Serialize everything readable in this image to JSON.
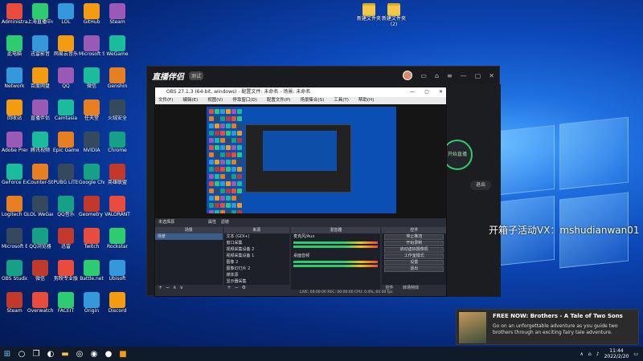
{
  "desktop": {
    "icons_col1": [
      "Administrator",
      "此电脑",
      "Network",
      "回收站",
      "Adobe Premiere Pro 2022",
      "GeForce Experience",
      "Logitech G HUB",
      "Microsoft Edge",
      "OBS Studio",
      "Steam"
    ],
    "icons_col2": [
      "上海直播中心",
      "迅雷影音",
      "百度网盘",
      "直播伴侣",
      "腾讯视频",
      "Counter-Strike",
      "LOL WeGame",
      "QQ浏览器",
      "微信",
      "Overwatch"
    ],
    "icons_col3": [
      "LOL",
      "网易云音乐",
      "QQ",
      "Camtasia",
      "Epic Games Launcher",
      "PUBG LITE",
      "QQ音乐",
      "迅雷",
      "剪映专业版",
      "FACEIT"
    ],
    "icons_col4": [
      "GitHub",
      "Microsoft Store",
      "微信",
      "任天堂",
      "NVIDIA",
      "Google Chrome",
      "Geometry Dash",
      "Twitch",
      "Battle.net",
      "Origin"
    ],
    "icons_col5": [
      "Steam",
      "WeGame",
      "Genshin",
      "火绒安全",
      "Chrome",
      "英雄联盟",
      "VALORANT",
      "Rockstar",
      "Ubisoft",
      "Discord"
    ],
    "folder1": "新建文件夹",
    "folder2": "新建文件夹 (2)"
  },
  "zb_window": {
    "title": "直播伴侣",
    "badge": "测试",
    "exit_label": "退出",
    "go_live_label": "开始直播"
  },
  "obs": {
    "title": "OBS 27.1.3 (64-bit, windows) - 配置文件: 未命名 - 场景: 未命名",
    "menu": [
      "文件(F)",
      "编辑(E)",
      "视图(V)",
      "停靠窗口(D)",
      "配置文件(P)",
      "场景集合(S)",
      "工具(T)",
      "帮助(H)"
    ],
    "source_bar_label": "未选择源",
    "properties_label": "属性",
    "filters_label": "滤镜",
    "panels": {
      "scenes_header": "场景",
      "sources_header": "来源",
      "mixer_header": "混音器",
      "controls_header": "控件",
      "scene_items": [
        "场景"
      ],
      "source_items": [
        "文本 (GDI+)",
        "窗口采集",
        "视频采集设备 2",
        "视频采集设备 1",
        "图像 2",
        "图像幻灯片 2",
        "媒体源",
        "显示器采集"
      ],
      "mixer_items": [
        "麦克风/Aux",
        "桌面音频"
      ],
      "controls": [
        "停止推流",
        "开始录制",
        "启动虚拟摄像机",
        "工作室模式",
        "设置",
        "退出"
      ],
      "tabs": [
        "控件",
        "转场特效"
      ]
    },
    "status": "LIVE: 00:00:00   REC: 00:00:00   CPU: 0.4%, 60.00 fps"
  },
  "watermark": "开箱子活动VX：mshudianwan01",
  "toast": {
    "title": "FREE NOW: Brothers - A Tale of Two Sons",
    "body": "Go on an unforgettable adventure as you guide two brothers through an exciting fairy tale adventure."
  },
  "taskbar": {
    "time": "11:44",
    "date": "2022/2/20"
  }
}
